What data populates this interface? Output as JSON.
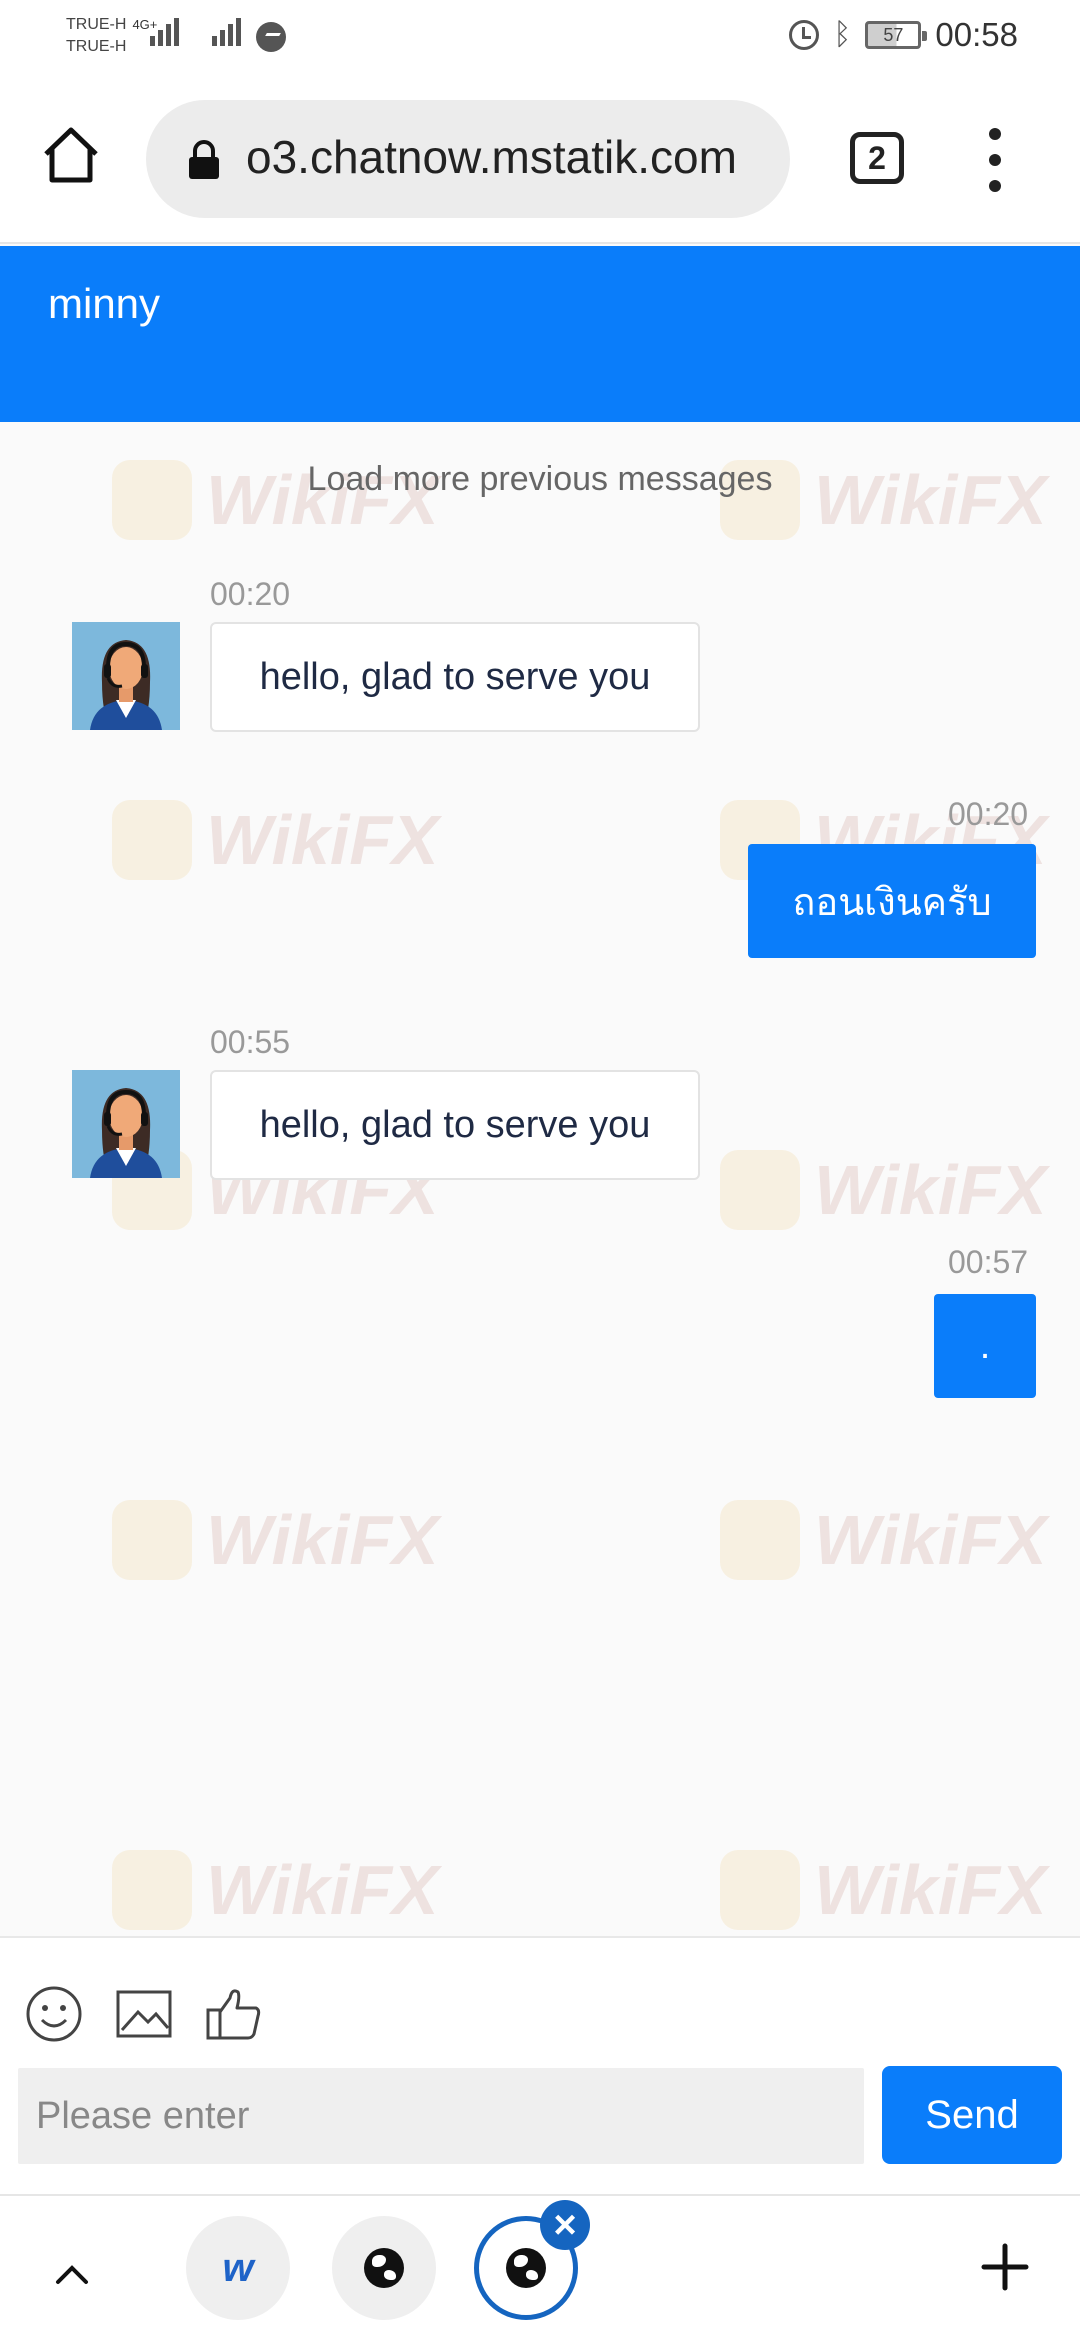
{
  "status_bar": {
    "carrier_1": "TRUE-H",
    "carrier_2": "TRUE-H",
    "network": "4G+",
    "battery": "57",
    "time": "00:58"
  },
  "browser": {
    "url": "o3.chatnow.mstatik.com",
    "tab_count": "2"
  },
  "chat": {
    "agent_name": "minny",
    "load_more": "Load more previous messages",
    "messages": [
      {
        "side": "incoming",
        "time": "00:20",
        "text": "hello, glad to serve you"
      },
      {
        "side": "outgoing",
        "time": "00:20",
        "text": "ถอนเงินครับ"
      },
      {
        "side": "incoming",
        "time": "00:55",
        "text": "hello, glad to serve you"
      },
      {
        "side": "outgoing",
        "time": "00:57",
        "text": "."
      }
    ]
  },
  "composer": {
    "placeholder": "Please enter",
    "send_label": "Send"
  },
  "bottom_bar": {
    "tab_1_logo": "w"
  },
  "watermark": {
    "text": "WikiFX"
  },
  "colors": {
    "accent": "#0a7dfa",
    "active_tab_ring": "#1565c0"
  }
}
